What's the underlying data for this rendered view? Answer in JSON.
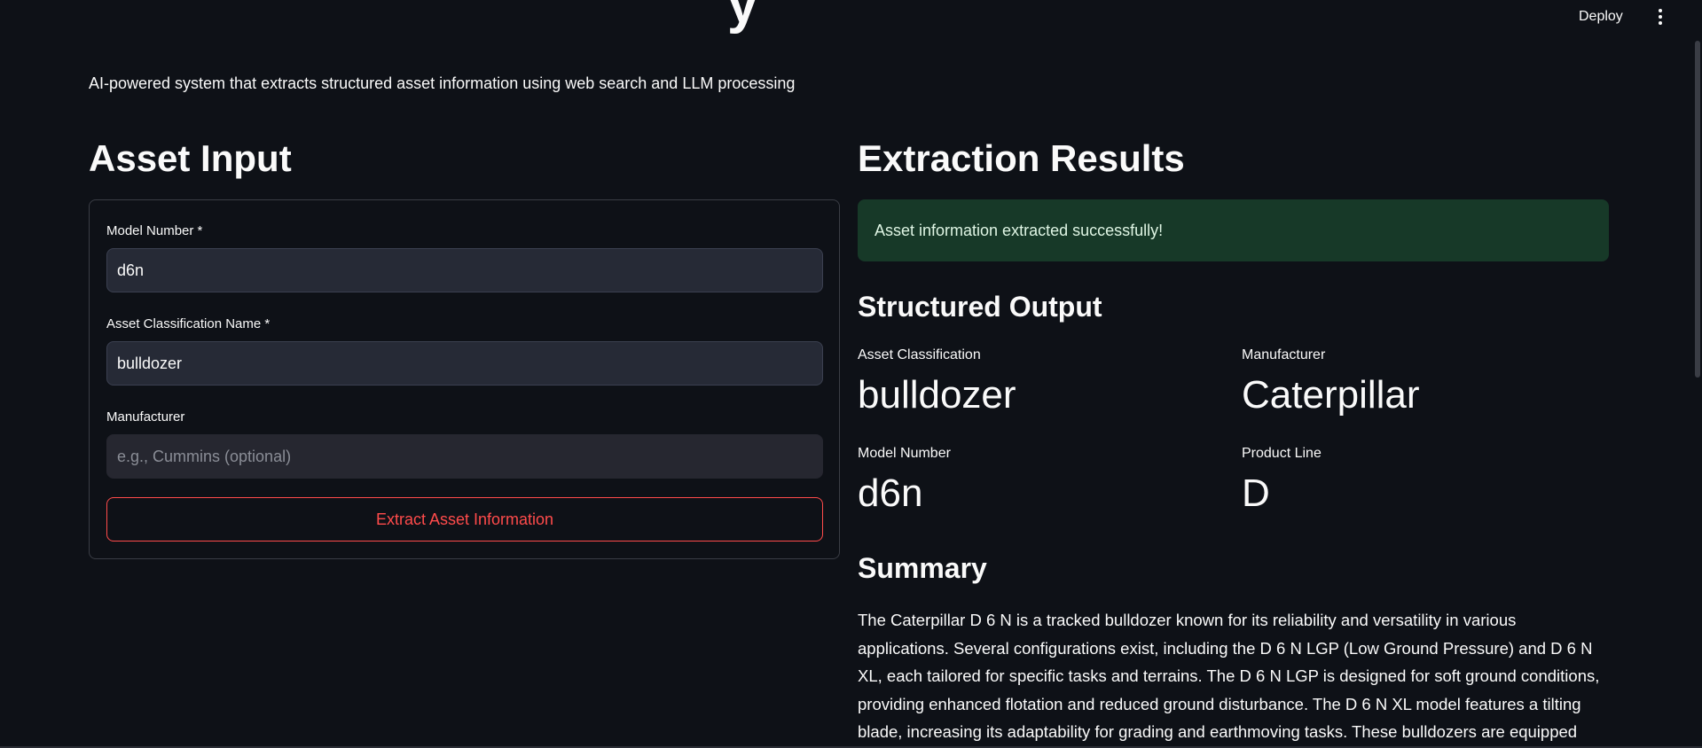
{
  "header": {
    "title_partial": "y",
    "deploy_label": "Deploy",
    "menu_icon": "vertical-ellipsis-icon"
  },
  "subtitle": "AI-powered system that extracts structured asset information using web search and LLM processing",
  "asset_input": {
    "heading": "Asset Input",
    "model_number": {
      "label": "Model Number *",
      "value": "d6n",
      "placeholder": ""
    },
    "asset_classification": {
      "label": "Asset Classification Name *",
      "value": "bulldozer",
      "placeholder": ""
    },
    "manufacturer": {
      "label": "Manufacturer",
      "value": "",
      "placeholder": "e.g., Cummins (optional)"
    },
    "extract_button_label": "Extract Asset Information"
  },
  "results": {
    "heading": "Extraction Results",
    "success_message": "Asset information extracted successfully!",
    "structured_heading": "Structured Output",
    "metrics": {
      "asset_classification": {
        "label": "Asset Classification",
        "value": "bulldozer"
      },
      "manufacturer": {
        "label": "Manufacturer",
        "value": "Caterpillar"
      },
      "model_number": {
        "label": "Model Number",
        "value": "d6n"
      },
      "product_line": {
        "label": "Product Line",
        "value": "D"
      }
    },
    "summary_heading": "Summary",
    "summary_text": "The Caterpillar D 6 N is a tracked bulldozer known for its reliability and versatility in various applications. Several configurations exist, including the D 6 N LGP (Low Ground Pressure) and D 6 N XL, each tailored for specific tasks and terrains. The D 6 N LGP is designed for soft ground conditions, providing enhanced flotation and reduced ground disturbance. The D 6 N XL model features a tilting blade, increasing its adaptability for grading and earthmoving tasks. These bulldozers are equipped"
  },
  "colors": {
    "background": "#0e1117",
    "accent": "#ff4b4b",
    "success_bg": "#173928",
    "input_bg": "#262a36"
  }
}
